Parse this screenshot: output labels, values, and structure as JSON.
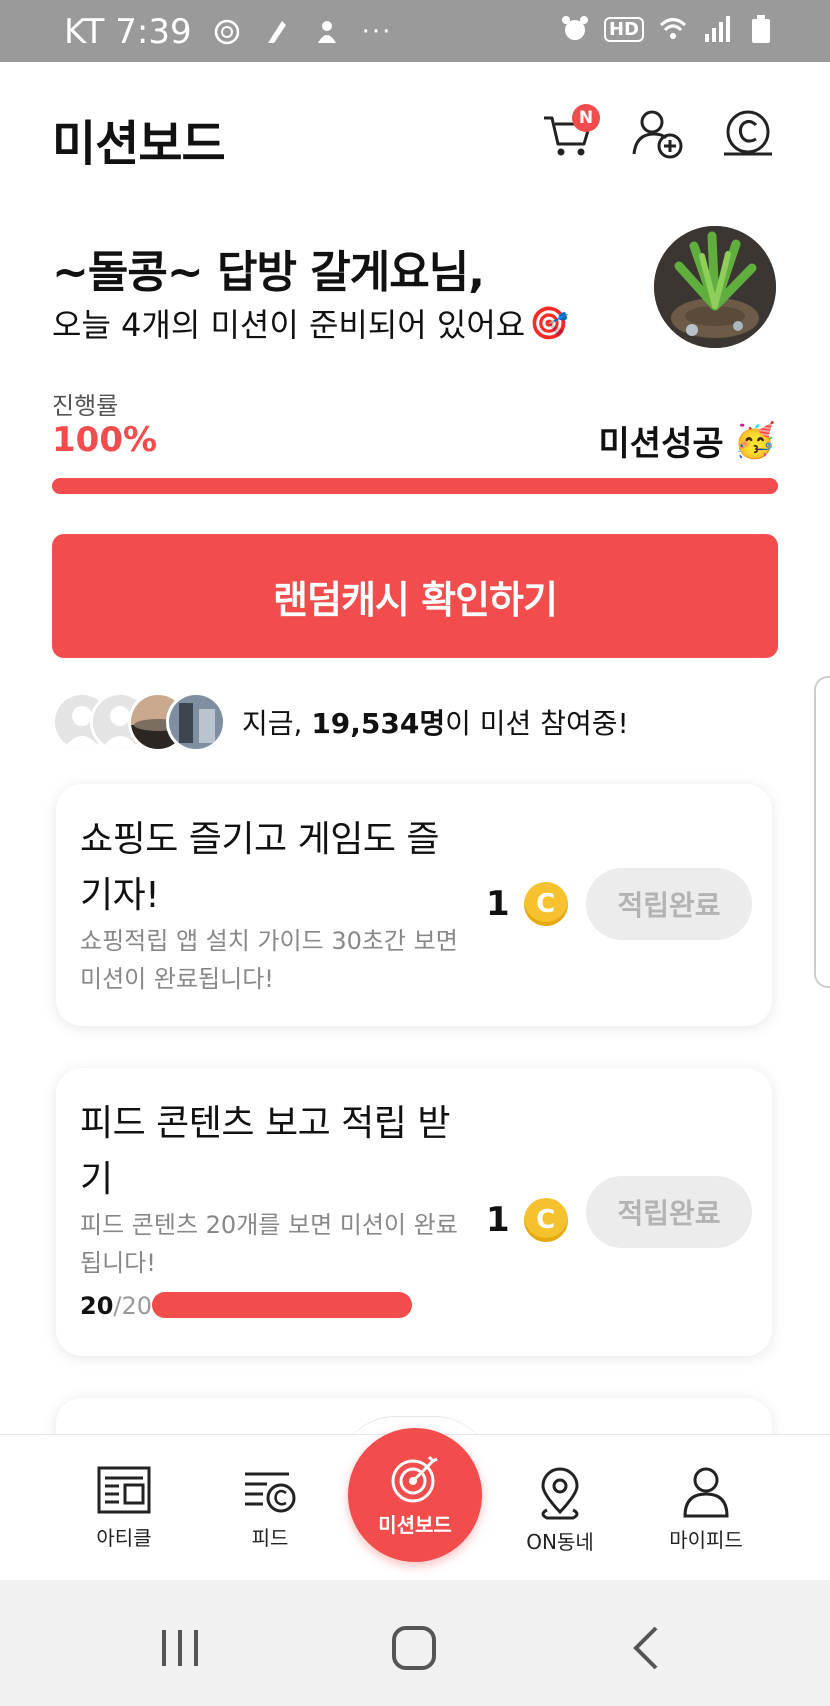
{
  "status_bar": {
    "carrier_time": "KT 7:39",
    "dots": "···",
    "hd_label": "HD"
  },
  "header": {
    "title": "미션보드",
    "cart_badge": "N"
  },
  "greeting": {
    "name": "~돌콩~ 답방 갈게요님,",
    "subtitle": "오늘 4개의 미션이 준비되어 있어요",
    "emoji": "🎯"
  },
  "progress": {
    "label": "진행률",
    "value_text": "100%",
    "value": 1.0,
    "status": "미션성공",
    "status_emoji": "🥳"
  },
  "cta": {
    "label": "랜덤캐시 확인하기"
  },
  "participants": {
    "prefix": "지금, ",
    "count": "19,534명",
    "suffix": "이 미션 참여중!"
  },
  "missions": [
    {
      "title": "쇼핑도 즐기고 게임도 즐기자!",
      "description": "쇼핑적립 앱 설치 가이드 30초간 보면 미션이 완료됩니다!",
      "reward": "1",
      "coin_symbol": "C",
      "button": "적립완료"
    },
    {
      "title": "피드 콘텐츠 보고 적립 받기",
      "description": "피드 콘텐츠 20개를 보면 미션이 완료됩니다!",
      "reward": "1",
      "coin_symbol": "C",
      "button": "적립완료",
      "count_done": "20",
      "count_total": "/20",
      "count_fraction": 1.0
    }
  ],
  "bottom_nav": {
    "items": [
      {
        "label": "아티클",
        "icon": "article-icon"
      },
      {
        "label": "피드",
        "icon": "feed-icon"
      },
      {
        "label": "미션보드",
        "icon": "target-icon"
      },
      {
        "label": "ON동네",
        "icon": "location-pin-icon"
      },
      {
        "label": "마이피드",
        "icon": "person-icon"
      }
    ]
  },
  "colors": {
    "accent": "#f24c4c",
    "coin": "#f6c12f",
    "muted": "#888888"
  }
}
